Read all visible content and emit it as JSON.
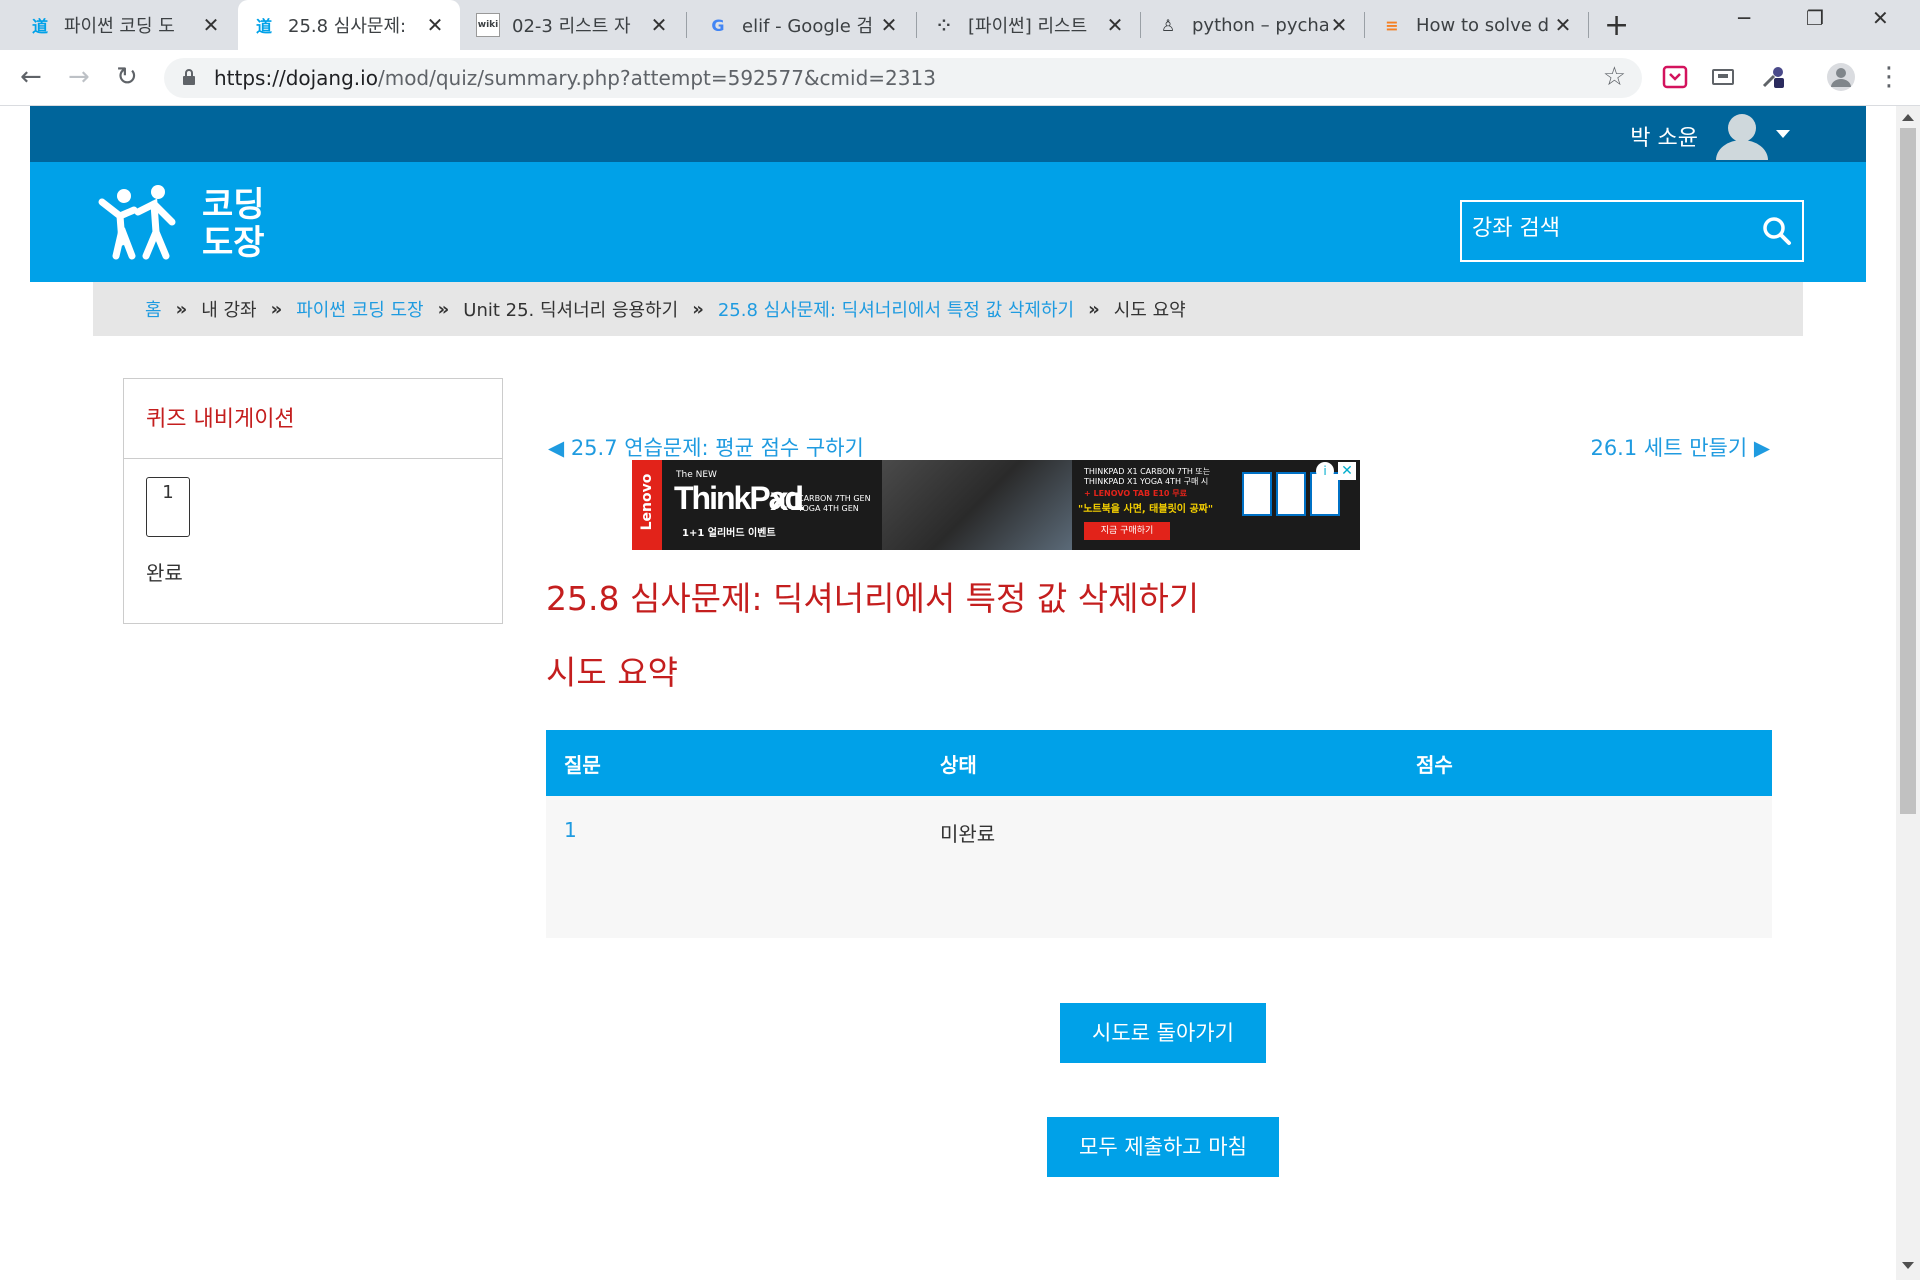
{
  "browser": {
    "tabs": [
      {
        "label": "파이썬 코딩 도",
        "favicon": "dojang-icon"
      },
      {
        "label": "25.8 심사문제: ",
        "favicon": "dojang-icon",
        "active": true
      },
      {
        "label": "02-3 리스트 자",
        "favicon": "wikidocs-icon"
      },
      {
        "label": "elif - Google 검",
        "favicon": "google-icon"
      },
      {
        "label": "[파이썬] 리스트",
        "favicon": "site-icon"
      },
      {
        "label": "python – pycha",
        "favicon": "site-icon"
      },
      {
        "label": "How to solve d",
        "favicon": "stackoverflow-icon"
      }
    ],
    "url_host": "https://dojang.io",
    "url_path": "/mod/quiz/summary.php?attempt=592577&cmid=2313"
  },
  "header": {
    "username": "박 소윤",
    "logo_line1": "코딩",
    "logo_line2": "도장",
    "search_placeholder": "강좌 검색"
  },
  "breadcrumb": [
    {
      "label": "홈",
      "link": true
    },
    {
      "label": "내 강좌",
      "link": false
    },
    {
      "label": "파이썬 코딩 도장",
      "link": true
    },
    {
      "label": "Unit 25. 딕셔너리 응용하기",
      "link": false
    },
    {
      "label": "25.8 심사문제: 딕셔너리에서 특정 값 삭제하기",
      "link": true
    },
    {
      "label": "시도 요약",
      "link": false
    }
  ],
  "breadcrumb_sep": "»",
  "sidebar": {
    "title": "퀴즈 내비게이션",
    "question_number": "1",
    "question_status": "완료"
  },
  "nav": {
    "prev": "◀ 25.7 연습문제: 평균 점수 구하기",
    "next": "26.1 세트 만들기 ▶"
  },
  "ad": {
    "brand": "Lenovo",
    "tag": "The NEW",
    "product": "ThinkPad",
    "model": "X1",
    "line1": "CARBON 7TH GEN",
    "line2": "YOGA 4TH GEN",
    "event": "1+1 얼리버드 이벤트",
    "promo1": "THINKPAD X1 CARBON 7TH 또는",
    "promo2": "THINKPAD X1 YOGA 4TH 구매 시",
    "promo3": "+ LENOVO TAB E10 무료",
    "promo4": "\"노트북을 사면, 태블릿이 공짜\"",
    "cta": "지금 구매하기"
  },
  "main": {
    "title": "25.8 심사문제: 딕셔너리에서 특정 값 삭제하기",
    "subtitle": "시도 요약",
    "table": {
      "headers": [
        "질문",
        "상태",
        "점수"
      ],
      "rows": [
        [
          "1",
          "미완료",
          ""
        ]
      ]
    },
    "return_button": "시도로 돌아가기",
    "submit_button": "모두 제출하고 마침"
  },
  "colors": {
    "topbar": "#00659b",
    "header": "#00a1e8",
    "accent_red": "#c41e1e",
    "link": "#1f9be0"
  }
}
